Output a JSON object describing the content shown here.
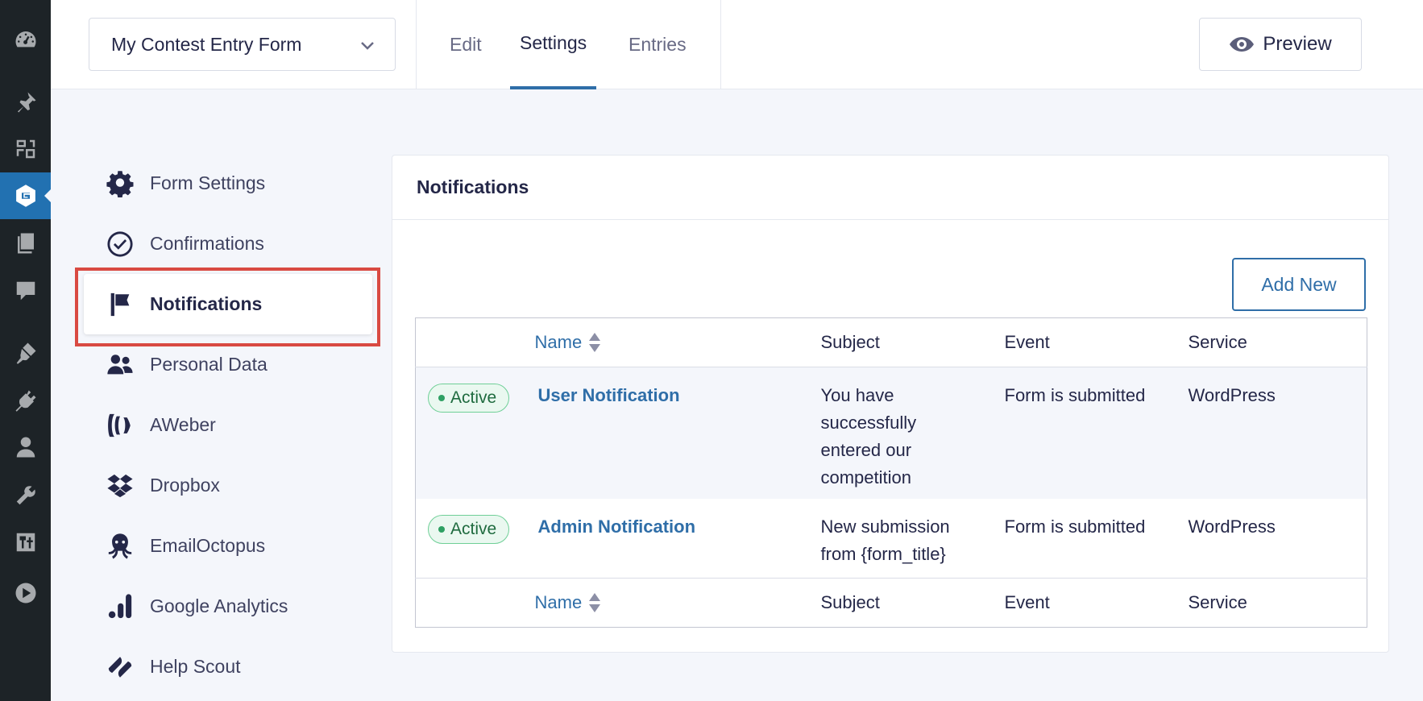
{
  "wp_sidebar": {
    "icons": [
      "dashboard-icon",
      "pin-icon",
      "media-icon",
      "gravity-forms-icon",
      "pages-icon",
      "comments-icon",
      "appearance-icon",
      "plugins-icon",
      "users-icon",
      "tools-icon",
      "settings-icon",
      "play-icon"
    ],
    "active": "gravity-forms-icon"
  },
  "header": {
    "form_select": "My Contest Entry Form",
    "tabs": [
      {
        "label": "Edit"
      },
      {
        "label": "Settings",
        "active": true
      },
      {
        "label": "Entries"
      }
    ],
    "preview_label": "Preview"
  },
  "settings_nav": {
    "items": [
      {
        "label": "Form Settings",
        "icon": "gear-icon"
      },
      {
        "label": "Confirmations",
        "icon": "check-circle-icon"
      },
      {
        "label": "Notifications",
        "icon": "flag-icon",
        "active": true
      },
      {
        "label": "Personal Data",
        "icon": "users-icon"
      },
      {
        "label": "AWeber",
        "icon": "aweber-icon"
      },
      {
        "label": "Dropbox",
        "icon": "dropbox-icon"
      },
      {
        "label": "EmailOctopus",
        "icon": "octopus-icon"
      },
      {
        "label": "Google Analytics",
        "icon": "analytics-icon"
      },
      {
        "label": "Help Scout",
        "icon": "helpscout-icon"
      }
    ]
  },
  "panel": {
    "title": "Notifications",
    "add_new_label": "Add New",
    "columns": [
      "Name",
      "Subject",
      "Event",
      "Service"
    ],
    "rows": [
      {
        "status": "Active",
        "name": "User Notification",
        "subject": "You have successfully entered our competition",
        "event": "Form is submitted",
        "service": "WordPress"
      },
      {
        "status": "Active",
        "name": "Admin Notification",
        "subject": "New submission from {form_title}",
        "event": "Form is submitted",
        "service": "WordPress"
      }
    ]
  },
  "colors": {
    "accent": "#2f6ea8",
    "wp_sidebar_bg": "#1d2327",
    "active_badge": "#2ea063",
    "highlight": "#d94a42"
  }
}
